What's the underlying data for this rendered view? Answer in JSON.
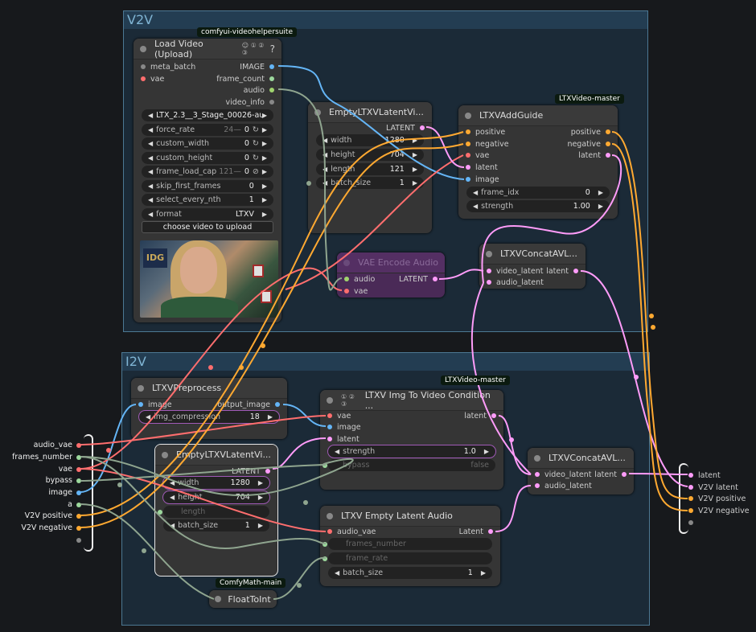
{
  "groups": {
    "v2v": {
      "title": "V2V"
    },
    "i2v": {
      "title": "I2V"
    }
  },
  "badges": {
    "vhs": "comfyui-videohelpersuite",
    "ltxvideo_1": "LTXVideo-master",
    "ltxvideo_2": "LTXVideo-master",
    "comfymath": "ComfyMath-main"
  },
  "load_video": {
    "title": "Load Video (Upload)",
    "header_icons": "☺ ① ② ③",
    "help": "?",
    "inputs": [
      "meta_batch",
      "vae"
    ],
    "outputs": [
      "IMAGE",
      "frame_count",
      "audio",
      "video_info"
    ],
    "widgets": [
      {
        "label": "LTX_2.3__3_Stage_00026-au...",
        "value": ""
      },
      {
        "label": "force_rate",
        "value": "0",
        "hint": "24—"
      },
      {
        "label": "custom_width",
        "value": "0"
      },
      {
        "label": "custom_height",
        "value": "0"
      },
      {
        "label": "frame_load_cap",
        "value": "0",
        "hint": "121—"
      },
      {
        "label": "skip_first_frames",
        "value": "0"
      },
      {
        "label": "select_every_nth",
        "value": "1"
      },
      {
        "label": "format",
        "value": "LTXV"
      }
    ],
    "button": "choose video to upload",
    "preview_sign": "IDG"
  },
  "empty_latent_v2v": {
    "title": "EmptyLTXVLatentVi...",
    "output": "LATENT",
    "widgets": [
      {
        "label": "width",
        "value": "1280"
      },
      {
        "label": "height",
        "value": "704"
      },
      {
        "label": "length",
        "value": "121"
      },
      {
        "label": "batch_size",
        "value": "1"
      }
    ]
  },
  "add_guide": {
    "title": "LTXVAddGuide",
    "inputs": [
      "positive",
      "negative",
      "vae",
      "latent",
      "image"
    ],
    "outputs": [
      "positive",
      "negative",
      "latent"
    ],
    "widgets": [
      {
        "label": "frame_idx",
        "value": "0"
      },
      {
        "label": "strength",
        "value": "1.00"
      }
    ]
  },
  "vae_encode_audio": {
    "title": "VAE Encode Audio",
    "inputs": [
      "audio",
      "vae"
    ],
    "output": "LATENT"
  },
  "concat_v2v": {
    "title": "LTXVConcatAVL...",
    "inputs": [
      "video_latent",
      "audio_latent"
    ],
    "output": "latent"
  },
  "preprocess": {
    "title": "LTXVPreprocess",
    "input": "image",
    "output": "output_image",
    "widgets": [
      {
        "label": "img_compression",
        "value": "18"
      }
    ]
  },
  "empty_latent_i2v": {
    "title": "EmptyLTXVLatentVi...",
    "output": "LATENT",
    "widgets": [
      {
        "label": "width",
        "value": "1280"
      },
      {
        "label": "height",
        "value": "704"
      },
      {
        "label": "length",
        "value": ""
      },
      {
        "label": "batch_size",
        "value": "1"
      }
    ]
  },
  "img_to_video": {
    "title": "LTXV Img To Video Condition ...",
    "header_icons": "① ② ③",
    "inputs": [
      "vae",
      "image",
      "latent"
    ],
    "output": "latent",
    "widgets": [
      {
        "label": "strength",
        "value": "1.0"
      },
      {
        "label": "bypass",
        "value": "false"
      }
    ]
  },
  "empty_audio": {
    "title": "LTXV Empty Latent Audio",
    "input": "audio_vae",
    "output": "Latent",
    "widgets": [
      {
        "label": "frames_number",
        "value": ""
      },
      {
        "label": "frame_rate",
        "value": ""
      },
      {
        "label": "batch_size",
        "value": "1"
      }
    ]
  },
  "concat_i2v": {
    "title": "LTXVConcatAVL...",
    "inputs": [
      "video_latent",
      "audio_latent"
    ],
    "output": "latent"
  },
  "float_to_int": {
    "title": "FloatToInt"
  },
  "subgraph_inputs": [
    "audio_vae",
    "frames_number",
    "vae",
    "bypass",
    "image",
    "a",
    "V2V positive",
    "V2V negative",
    ""
  ],
  "subgraph_outputs": [
    "latent",
    "V2V latent",
    "V2V positive",
    "V2V negative",
    ""
  ],
  "colors": {
    "image": "#64b5f6",
    "vae": "#ff6e6e",
    "latent": "#ff9cf9",
    "conditioning": "#ffa931",
    "audio": "#a0d46e",
    "int": "#9cd89c",
    "group_border": "#4c7893",
    "vae_encode_audio_bg": "#4a2a57"
  }
}
